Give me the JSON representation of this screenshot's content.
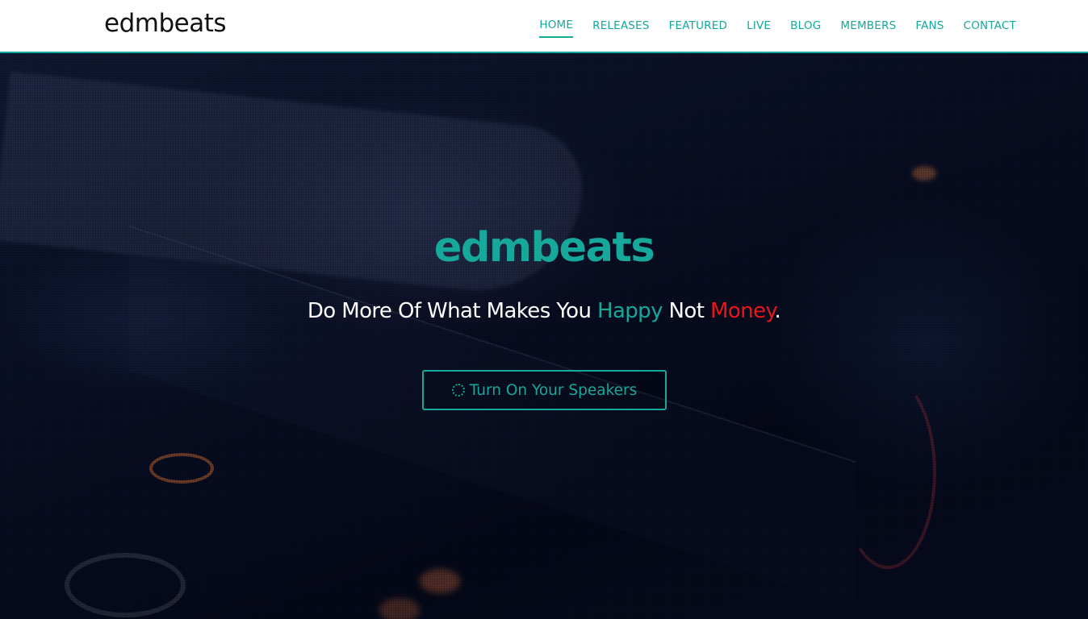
{
  "brand": {
    "logo": "edmbeats"
  },
  "nav": {
    "items": [
      {
        "label": "HOME",
        "active": true
      },
      {
        "label": "RELEASES",
        "active": false
      },
      {
        "label": "FEATURED",
        "active": false
      },
      {
        "label": "LIVE",
        "active": false
      },
      {
        "label": "BLOG",
        "active": false
      },
      {
        "label": "MEMBERS",
        "active": false
      },
      {
        "label": "FANS",
        "active": false
      },
      {
        "label": "CONTACT",
        "active": false
      }
    ]
  },
  "hero": {
    "logo": "edmbeats",
    "tagline": {
      "part1": "Do More Of What Makes You ",
      "happy": "Happy",
      "part2": " Not ",
      "money": "Money",
      "end": "."
    },
    "cta": {
      "label": "Turn On Your Speakers",
      "icon": "spinner-icon"
    }
  },
  "colors": {
    "accent": "#16a89a",
    "highlight_red": "#e8151b",
    "nav_bg": "#ffffff",
    "hero_bg": "#06091c"
  }
}
